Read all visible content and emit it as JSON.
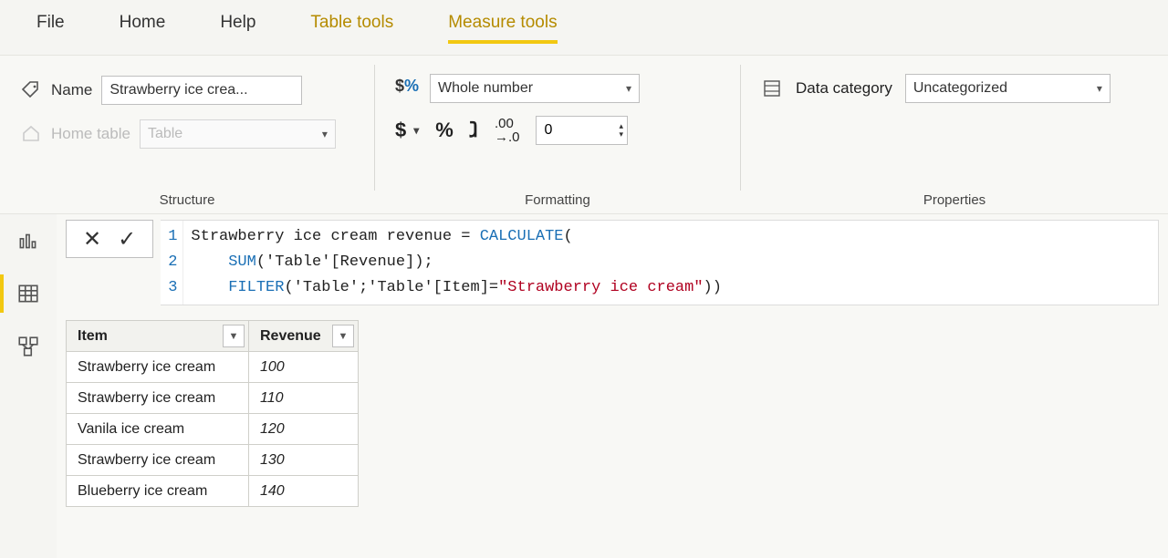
{
  "menu": {
    "file": "File",
    "home": "Home",
    "help": "Help",
    "table_tools": "Table tools",
    "measure_tools": "Measure tools"
  },
  "ribbon": {
    "structure": {
      "label": "Structure",
      "name_label": "Name",
      "name_value": "Strawberry ice crea...",
      "home_table_label": "Home table",
      "home_table_value": "Table"
    },
    "formatting": {
      "label": "Formatting",
      "format_value": "Whole number",
      "decimals_value": "0"
    },
    "properties": {
      "label": "Properties",
      "category_label": "Data category",
      "category_value": "Uncategorized"
    }
  },
  "formula": {
    "line_numbers": [
      "1",
      "2",
      "3"
    ],
    "l1_a": "Strawberry ice cream revenue = ",
    "l1_fn": "CALCULATE",
    "l1_b": "(",
    "l2_pad": "    ",
    "l2_fn": "SUM",
    "l2_b": "('Table'[Revenue]);",
    "l3_pad": "    ",
    "l3_fn": "FILTER",
    "l3_b": "('Table';'Table'[Item]=",
    "l3_str": "\"Strawberry ice cream\"",
    "l3_c": "))"
  },
  "table": {
    "col_item": "Item",
    "col_revenue": "Revenue",
    "rows": [
      {
        "item": "Strawberry ice cream",
        "rev": "100"
      },
      {
        "item": "Strawberry ice cream",
        "rev": "110"
      },
      {
        "item": "Vanila ice cream",
        "rev": "120"
      },
      {
        "item": "Strawberry ice cream",
        "rev": "130"
      },
      {
        "item": "Blueberry ice cream",
        "rev": "140"
      }
    ]
  }
}
